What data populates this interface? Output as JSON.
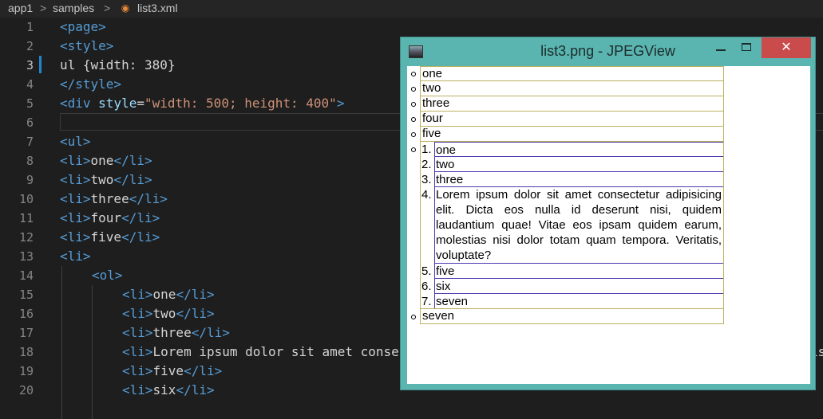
{
  "breadcrumb": {
    "items": [
      "app1",
      "samples",
      "list3.xml"
    ],
    "separator": ">",
    "file_icon": "rss-icon"
  },
  "editor": {
    "line_numbers": [
      "1",
      "2",
      "3",
      "4",
      "5",
      "6",
      "7",
      "8",
      "9",
      "10",
      "11",
      "12",
      "13",
      "14",
      "15",
      "16",
      "17",
      "18",
      "19",
      "20"
    ],
    "active_line": "3",
    "lines": {
      "l1": {
        "tag": "<page>"
      },
      "l2": {
        "tag": "<style>"
      },
      "l3": {
        "text": "ul {width: 380}"
      },
      "l4": {
        "tag": "</style>"
      },
      "l5": {
        "open": "<div ",
        "attr": "style",
        "eq": "=",
        "str": "\"width: 500; height: 400\"",
        "close": ">"
      },
      "l7": {
        "tag": "<ul>"
      },
      "l8": {
        "open": "<li>",
        "text": "one",
        "close": "</li>"
      },
      "l9": {
        "open": "<li>",
        "text": "two",
        "close": "</li>"
      },
      "l10": {
        "open": "<li>",
        "text": "three",
        "close": "</li>"
      },
      "l11": {
        "open": "<li>",
        "text": "four",
        "close": "</li>"
      },
      "l12": {
        "open": "<li>",
        "text": "five",
        "close": "</li>"
      },
      "l13": {
        "tag": "<li>"
      },
      "l14": {
        "tag": "<ol>"
      },
      "l15": {
        "open": "<li>",
        "text": "one",
        "close": "</li>"
      },
      "l16": {
        "open": "<li>",
        "text": "two",
        "close": "</li>"
      },
      "l17": {
        "open": "<li>",
        "text": "three",
        "close": "</li>"
      },
      "l18": {
        "open": "<li>",
        "text": "Lorem ipsum dolor sit amet conse",
        "tail": "is"
      },
      "l19": {
        "open": "<li>",
        "text": "five",
        "close": "</li>"
      },
      "l20": {
        "open": "<li>",
        "text": "six",
        "close": "</li>"
      }
    }
  },
  "viewer": {
    "title": "list3.png - JPEGView",
    "close_label": "✕",
    "ul_items": [
      "one",
      "two",
      "three",
      "four",
      "five",
      "seven"
    ],
    "ol_items": [
      "one",
      "two",
      "three",
      "Lorem ipsum dolor sit amet consectetur adipisicing elit. Dicta eos nulla id deserunt nisi, quidem laudantium quae! Vitae eos ipsam quidem earum, molestias nisi dolor totam quam tempora. Veritatis, voluptate?",
      "five",
      "six",
      "seven"
    ],
    "ol_numbers": [
      "1.",
      "2.",
      "3.",
      "4.",
      "5.",
      "6.",
      "7."
    ]
  }
}
